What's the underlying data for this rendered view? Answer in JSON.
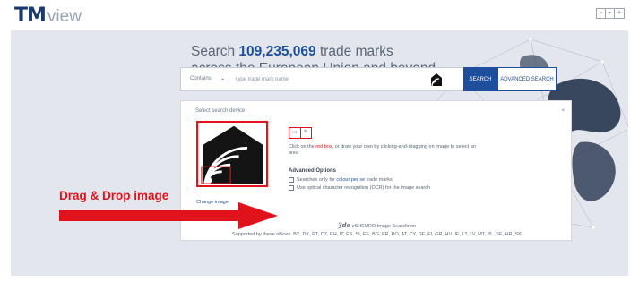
{
  "header": {
    "logo_tm": "TM",
    "logo_view": "view",
    "lang_icons": [
      "-",
      "▪",
      "+"
    ]
  },
  "hero": {
    "headline_prefix": "Search",
    "headline_count": "109,235,069",
    "headline_suffix": "trade marks",
    "headline_line2": "across the European Union and beyond"
  },
  "search": {
    "contains_label": "Contains",
    "placeholder": "Type trade mark name",
    "search_button": "SEARCH",
    "advanced_button": "ADVANCED SEARCH",
    "image_icon": "image-search-icon"
  },
  "panel": {
    "title": "Select search device",
    "close": "×",
    "change_image": "Change image",
    "instruction_1": "Click on the",
    "instruction_red": "red box,",
    "instruction_2": "or draw your own by clicking-and-dragging on image to select an area",
    "advanced_title": "Advanced Options",
    "option1_a": "Searches only for",
    "option1_blue": "colour per se",
    "option1_b": "trade marks",
    "option2": "Use optical character recognition (OCR) for the image search",
    "powered_logo": "Ȝde",
    "powered_text": "eSHEURO Image Searchnon",
    "supported": "Supported by these offices: BX, DK, PT, CZ, EH, IT, ES, SI, EE, BG, FR, RO, AT, CY, DE, FI, GR, HU, IE, LT, LV, MT, PL, SE, HR, SK"
  },
  "annotation": {
    "label": "Drag & Drop image",
    "color": "#e0121b"
  },
  "colors": {
    "brand": "#1d4f9c",
    "accent_red": "#e0121b",
    "hero_bg": "#e3e7ed"
  }
}
